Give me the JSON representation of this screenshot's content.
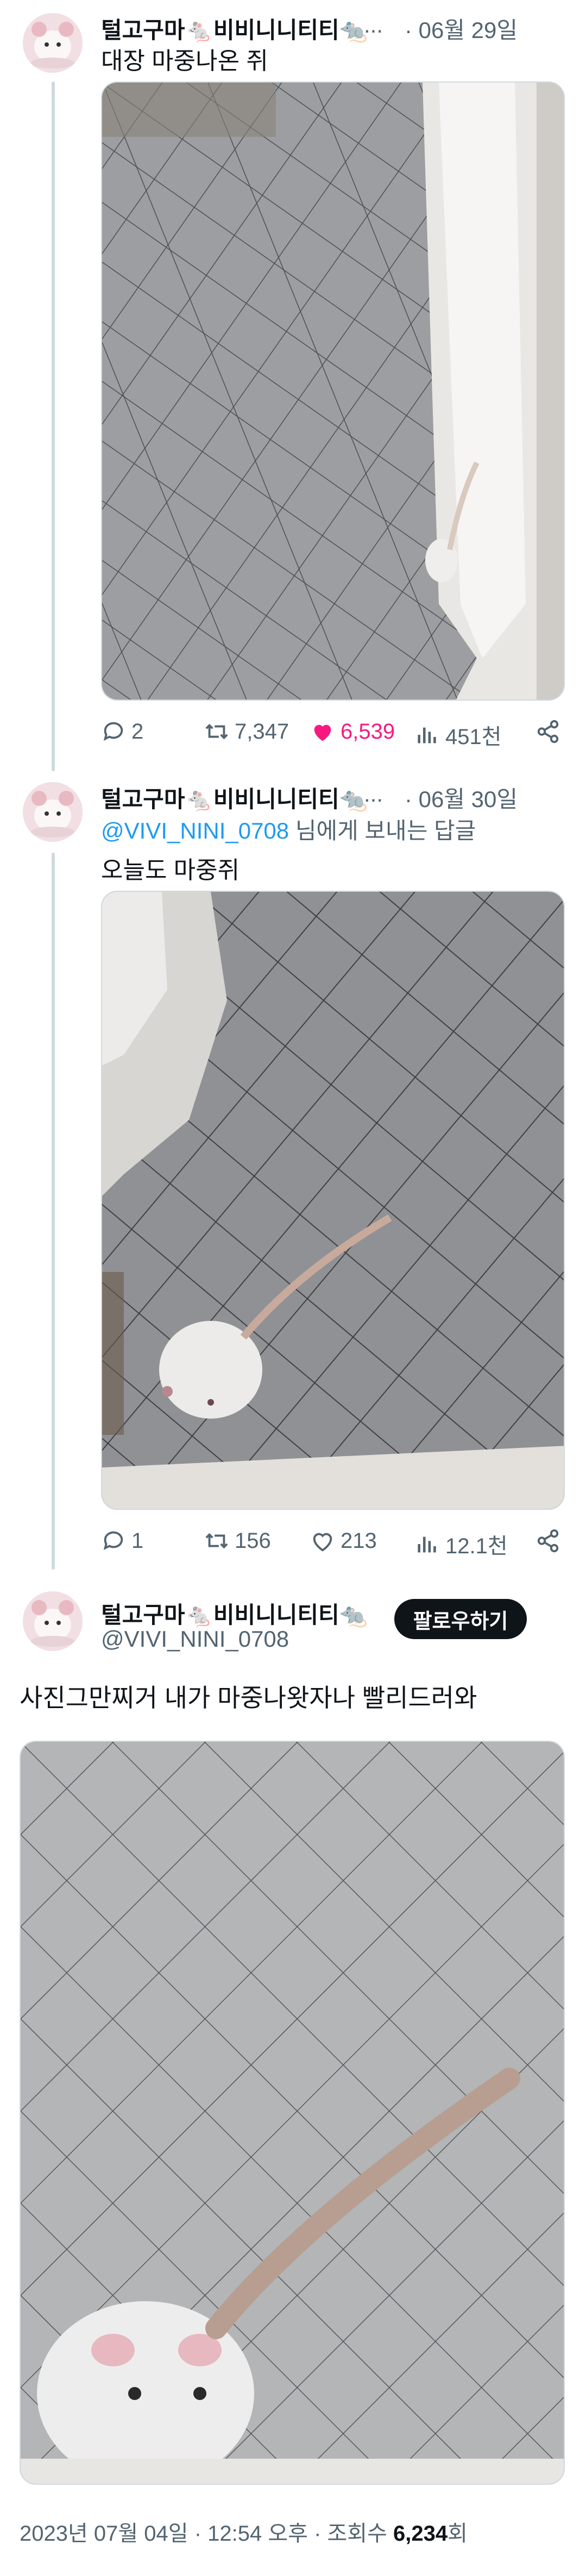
{
  "tweets": [
    {
      "display_name": "털고구마🐁비비니니티티🐀",
      "ellipsis": "...",
      "date": "· 06월 29일",
      "text": "대장 마중나온 쥐",
      "actions": {
        "replies": "2",
        "retweets": "7,347",
        "likes": "6,539",
        "views": "451천"
      }
    },
    {
      "display_name": "털고구마🐁비비니니티티🐀",
      "ellipsis": "...",
      "date": "· 06월 30일",
      "reply_mention": "@VIVI_NINI_0708",
      "reply_suffix": " 님에게 보내는 답글",
      "text": "오늘도 마중쥐",
      "actions": {
        "replies": "1",
        "retweets": "156",
        "likes": "213",
        "views": "12.1천"
      }
    }
  ],
  "main_tweet": {
    "display_name": "털고구마🐁비비니니티티🐀",
    "handle": "@VIVI_NINI_0708",
    "follow_label": "팔로우하기",
    "text": "사진그만찌거 내가 마중나왓자나 빨리드러와",
    "timestamp": "2023년 07월 04일 · 12:54 오후 · 조회수 ",
    "views": "6,234",
    "views_suffix": "회"
  },
  "icons": [
    "reply-icon",
    "retweet-icon",
    "like-icon",
    "views-icon",
    "share-icon"
  ],
  "colors": {
    "like_active": "#f91880",
    "mention": "#1d9bf0",
    "muted": "#536471"
  }
}
